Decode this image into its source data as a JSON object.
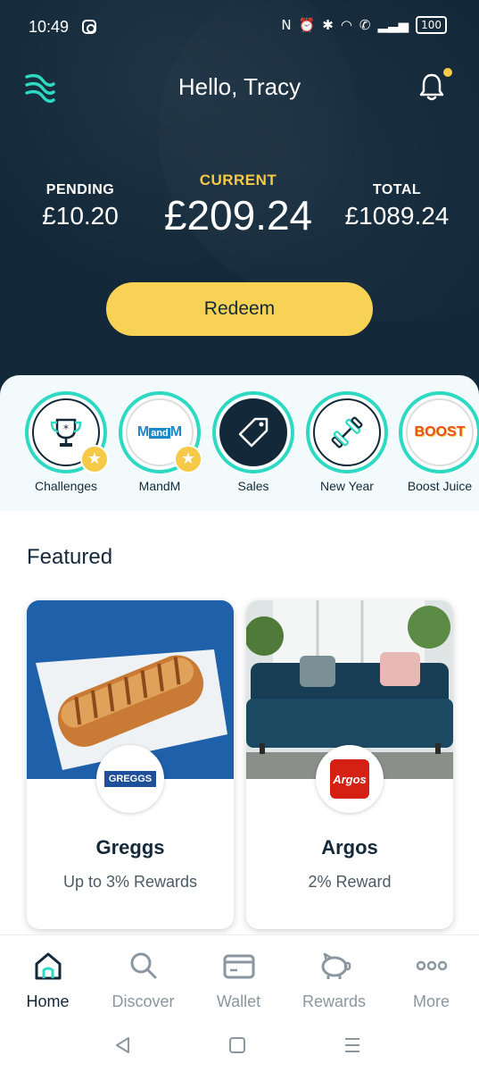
{
  "status_bar": {
    "time": "10:49",
    "battery": "100"
  },
  "header": {
    "greeting": "Hello, Tracy"
  },
  "balances": {
    "pending_label": "PENDING",
    "pending_value": "£10.20",
    "current_label": "CURRENT",
    "current_value": "£209.24",
    "total_label": "TOTAL",
    "total_value": "£1089.24"
  },
  "redeem_label": "Redeem",
  "categories": [
    {
      "label": "Challenges"
    },
    {
      "label": "MandM",
      "logo_text_a": "M",
      "logo_text_b": "and",
      "logo_text_c": "M"
    },
    {
      "label": "Sales"
    },
    {
      "label": "New Year"
    },
    {
      "label": "Boost Juice",
      "logo_text": "BOOST"
    }
  ],
  "featured": {
    "title": "Featured",
    "cards": [
      {
        "name": "Greggs",
        "reward": "Up to 3% Rewards",
        "logo_text": "GREGGS"
      },
      {
        "name": "Argos",
        "reward": "2% Reward",
        "logo_text": "Argos"
      }
    ]
  },
  "bottom_nav": [
    {
      "label": "Home",
      "icon": "home-icon"
    },
    {
      "label": "Discover",
      "icon": "search-icon"
    },
    {
      "label": "Wallet",
      "icon": "wallet-icon"
    },
    {
      "label": "Rewards",
      "icon": "piggy-bank-icon"
    },
    {
      "label": "More",
      "icon": "more-icon"
    }
  ],
  "colors": {
    "header_bg": "#13293a",
    "accent_yellow": "#f7c948",
    "accent_teal": "#2ed9c3"
  }
}
